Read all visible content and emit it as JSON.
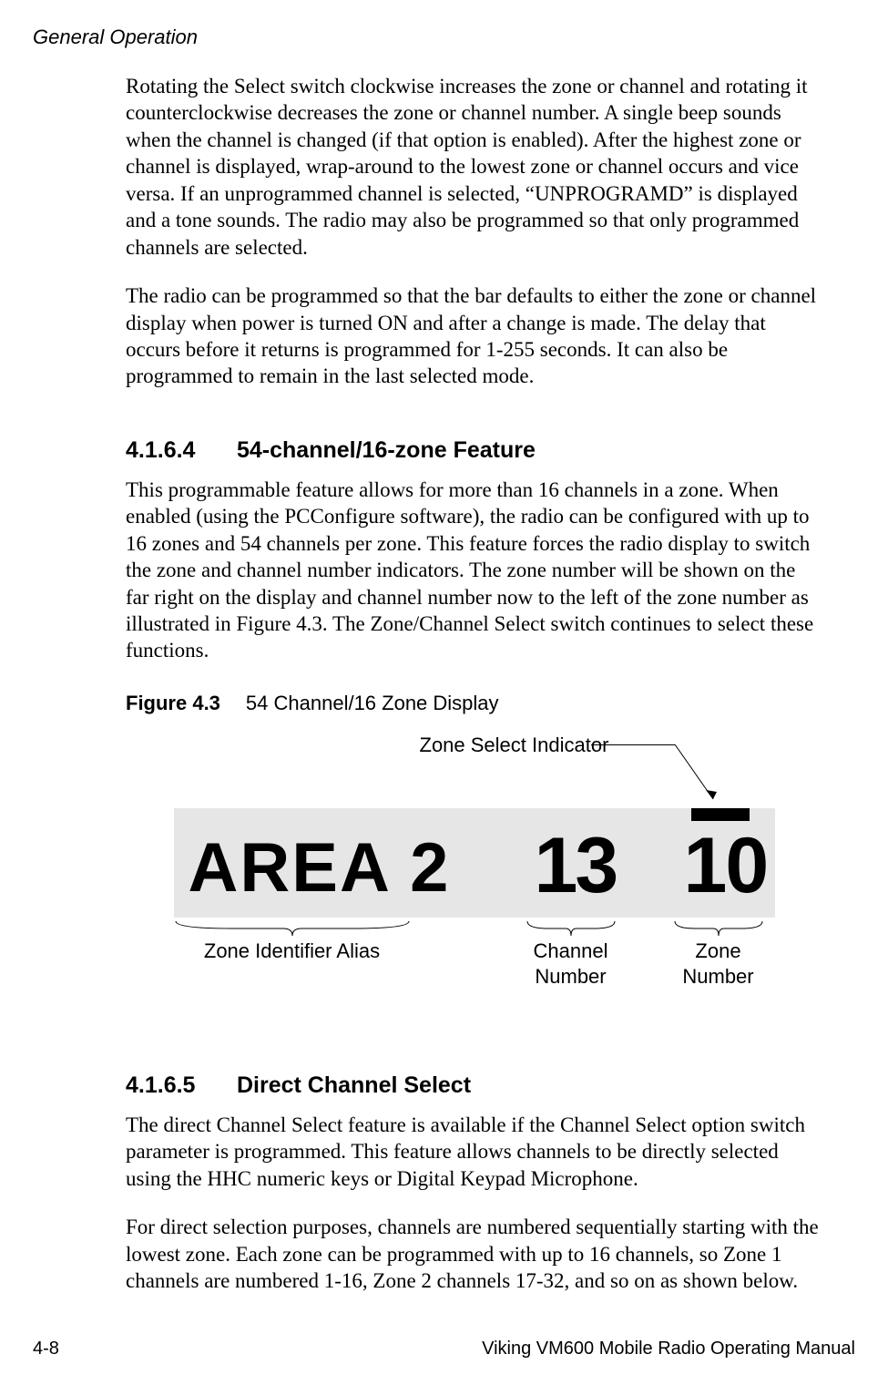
{
  "header": {
    "section_title": "General Operation"
  },
  "paragraphs": {
    "p1": "Rotating the Select switch clockwise increases the zone or channel and rotating it counterclockwise decreases the zone or channel number. A single beep sounds when the channel is changed (if that option is enabled). After the highest zone or channel is displayed, wrap-around to the lowest zone or channel occurs and vice versa. If an unprogrammed channel is selected, “UNPROGRAMD” is displayed and a tone sounds. The radio may also be programmed so that only programmed channels are selected.",
    "p2": "The radio can be programmed so that the bar defaults to either the zone or channel display when power is turned ON and after a change is made. The delay that occurs before it returns is programmed for 1-255 seconds. It can also be programmed to remain in the last selected mode."
  },
  "section_4_1_6_4": {
    "num": "4.1.6.4",
    "title": "54-channel/16-zone Feature",
    "body": "This programmable feature allows for more than 16 channels in a zone. When enabled (using the PCConfigure software), the radio can be configured with up to 16 zones and 54 channels per zone. This feature forces the radio display to switch the zone and channel number indicators. The zone number will be shown on the far right on the display and channel number now to the left of the zone number as illustrated in Figure 4.3. The Zone/Channel Select switch continues to select these functions."
  },
  "figure_4_3": {
    "num": "Figure 4.3",
    "title": "54 Channel/16 Zone Display",
    "callout_top": "Zone Select Indicator",
    "lcd_text": {
      "alias": "AREA 2",
      "channel": "13",
      "zone": "10"
    },
    "callout_alias": "Zone Identifier Alias",
    "callout_channel_l1": "Channel",
    "callout_channel_l2": "Number",
    "callout_zone_l1": "Zone",
    "callout_zone_l2": "Number"
  },
  "section_4_1_6_5": {
    "num": "4.1.6.5",
    "title": "Direct Channel Select",
    "body1": "The direct Channel Select feature is available if the Channel Select option switch parameter is programmed. This feature allows channels to be directly selected using the HHC numeric keys or Digital Keypad Microphone.",
    "body2": "For direct selection purposes, channels are numbered sequentially starting with the lowest zone. Each zone can be programmed with up to 16 channels, so Zone 1 channels are numbered 1-16, Zone 2 channels 17-32, and so on as shown below."
  },
  "footer": {
    "page": "4-8",
    "book": "Viking VM600 Mobile Radio Operating Manual"
  }
}
